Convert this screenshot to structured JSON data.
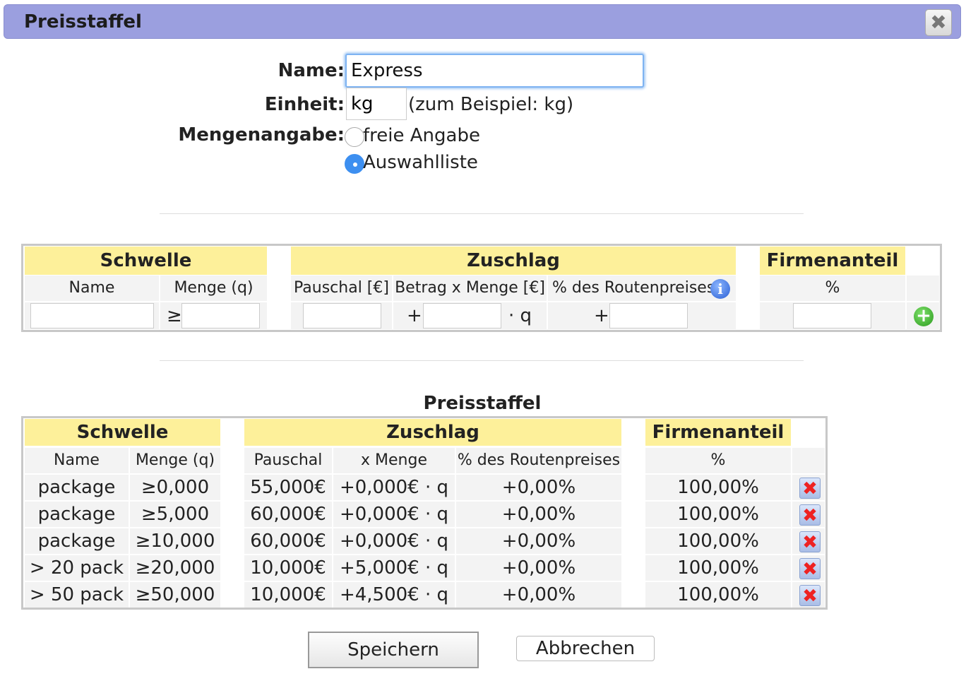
{
  "dialog": {
    "title": "Preisstaffel",
    "close_symbol": "✖"
  },
  "form": {
    "name_label": "Name:",
    "name_value": "Express",
    "unit_label": "Einheit:",
    "unit_value": "kg",
    "unit_hint": "(zum Beispiel: kg)",
    "quantity_label": "Mengenangabe:",
    "option_free": "freie Angabe",
    "option_list": "Auswahlliste",
    "selected_option": "Auswahlliste"
  },
  "input_table": {
    "group_threshold": "Schwelle",
    "group_surcharge": "Zuschlag",
    "group_share": "Firmenanteil",
    "col_name": "Name",
    "col_amount": "Menge (q)",
    "col_flat": "Pauschal [€]",
    "col_per_amount": "Betrag x Menge [€]",
    "col_route_pct": "% des Routenpreises",
    "col_share_pct": "%",
    "sym_ge": "≥",
    "sym_plus": "+",
    "sym_times_q": "· q",
    "sym_plus2": "+",
    "add_symbol": "+",
    "info_symbol": "i"
  },
  "tiers": {
    "title": "Preisstaffel",
    "group_threshold": "Schwelle",
    "group_surcharge": "Zuschlag",
    "group_share": "Firmenanteil",
    "col_name": "Name",
    "col_amount": "Menge (q)",
    "col_flat": "Pauschal",
    "col_per_amount": "x Menge",
    "col_route_pct": "% des Routenpreises",
    "col_share_pct": "%",
    "rows": [
      {
        "name": "package",
        "amount": "≥0,000",
        "flat": "55,000€",
        "per_amount": "+0,000€ · q",
        "route_pct": "+0,00%",
        "share": "100,00%"
      },
      {
        "name": "package",
        "amount": "≥5,000",
        "flat": "60,000€",
        "per_amount": "+0,000€ · q",
        "route_pct": "+0,00%",
        "share": "100,00%"
      },
      {
        "name": "package",
        "amount": "≥10,000",
        "flat": "60,000€",
        "per_amount": "+0,000€ · q",
        "route_pct": "+0,00%",
        "share": "100,00%"
      },
      {
        "name": "> 20 pack",
        "amount": "≥20,000",
        "flat": "10,000€",
        "per_amount": "+5,000€ · q",
        "route_pct": "+0,00%",
        "share": "100,00%"
      },
      {
        "name": "> 50 pack",
        "amount": "≥50,000",
        "flat": "10,000€",
        "per_amount": "+4,500€ · q",
        "route_pct": "+0,00%",
        "share": "100,00%"
      }
    ],
    "delete_symbol": "✖"
  },
  "buttons": {
    "save": "Speichern",
    "cancel": "Abbrechen"
  },
  "colors": {
    "titlebar": "#9b9fdf",
    "header_yellow": "#fdf09a",
    "focus_blue": "#7eb3f2",
    "radio_selected": "#3d8ff0"
  }
}
